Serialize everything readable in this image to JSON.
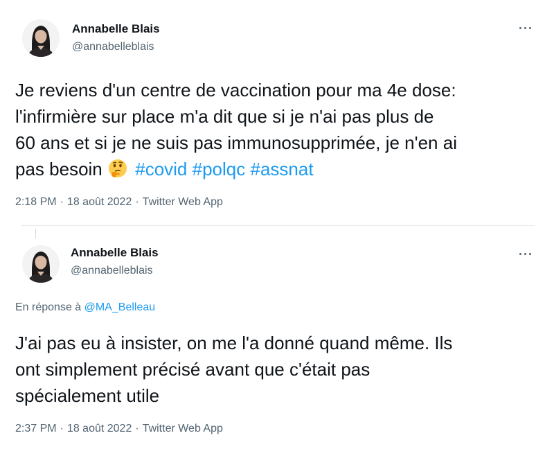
{
  "tweets": [
    {
      "author_name": "Annabelle Blais",
      "author_handle": "@annabelleblais",
      "text_lines": [
        "Je reviens d'un centre de vaccination pour ma 4e dose:",
        "l'infirmière sur place m'a dit que si je n'ai pas plus de",
        "60 ans et si je ne suis pas immunosupprimée, je n'en ai",
        "pas besoin"
      ],
      "emoji": "thinking-face",
      "hashtags": [
        "#covid",
        "#polqc",
        "#assnat"
      ],
      "time": "2:18 PM",
      "date": "18 août 2022",
      "source": "Twitter Web App",
      "separator": "·"
    },
    {
      "author_name": "Annabelle Blais",
      "author_handle": "@annabelleblais",
      "reply_prefix": "En réponse à",
      "reply_to": "@MA_Belleau",
      "text_lines": [
        "J'ai pas eu à insister, on me l'a donné quand même. Ils",
        "ont simplement précisé avant que c'était pas",
        "spécialement utile"
      ],
      "time": "2:37 PM",
      "date": "18 août 2022",
      "source": "Twitter Web App",
      "separator": "·"
    }
  ],
  "icons": {
    "more": "more-options-icon",
    "emoji": "thinking-face-emoji"
  },
  "colors": {
    "text": "#0f1419",
    "secondary": "#536471",
    "link": "#1d9bf0"
  }
}
